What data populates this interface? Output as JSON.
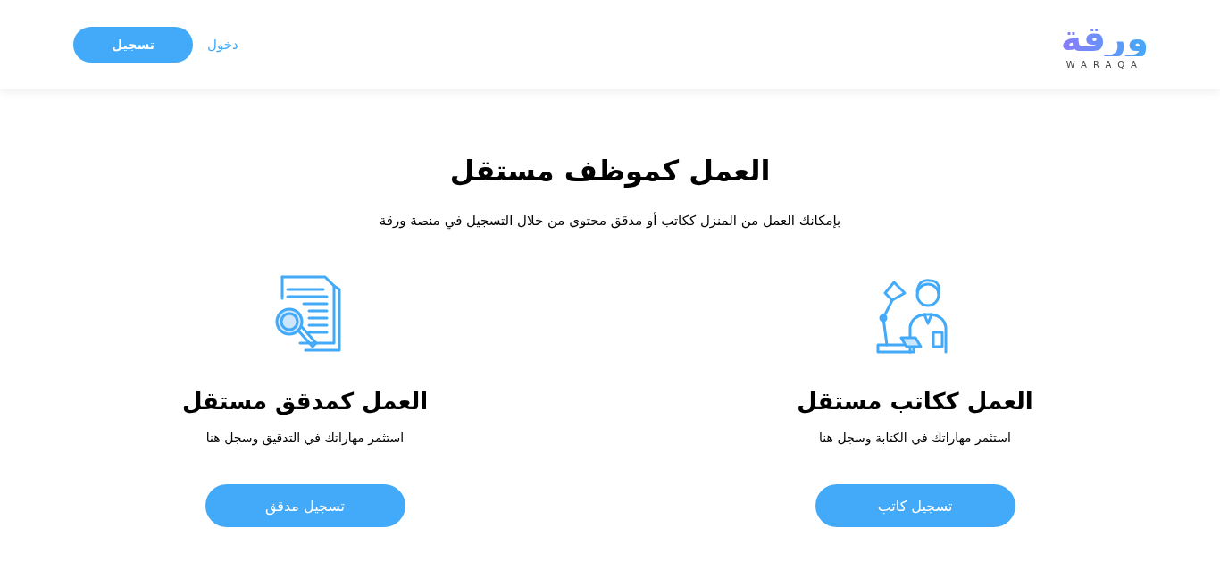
{
  "header": {
    "logo": {
      "text": "ورقة",
      "subtitle": "WARAQA"
    },
    "register_button": "تسجيل",
    "login_link": "دخول"
  },
  "hero": {
    "title": "العمل كموظف مستقل",
    "subtitle": "بإمكانك العمل من المنزل ككاتب أو مدقق محتوى من خلال التسجيل في منصة ورقة"
  },
  "cards": [
    {
      "kind": "writer",
      "title": "العمل ككاتب مستقل",
      "description": "استثمر مهاراتك في الكتابة وسجل هنا",
      "button": "تسجيل كاتب"
    },
    {
      "kind": "proofreader",
      "title": "العمل كمدقق مستقل",
      "description": "استثمر مهاراتك في التدقيق وسجل هنا",
      "button": "تسجيل مدقق"
    }
  ]
}
